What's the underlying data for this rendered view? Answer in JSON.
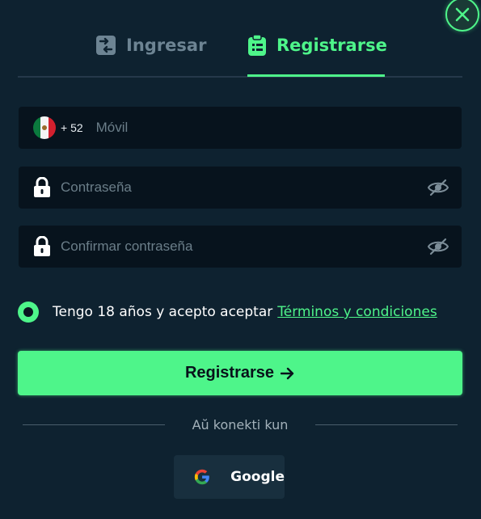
{
  "close": {
    "icon": "close-icon"
  },
  "tabs": {
    "login": {
      "label": "Ingresar",
      "icon": "login-icon"
    },
    "register": {
      "label": "Registrarse",
      "icon": "clipboard-icon",
      "active": true
    }
  },
  "phone": {
    "country": "Mexico",
    "dial_code": "+ 52",
    "placeholder": "Móvil"
  },
  "password": {
    "placeholder": "Contraseña"
  },
  "confirm_password": {
    "placeholder": "Confirmar contraseña"
  },
  "terms": {
    "text": "Tengo 18 años y acepto aceptar",
    "link": "Términos y condiciones",
    "checked": true
  },
  "submit": {
    "label": "Registrarse",
    "icon": "arrow-right-icon"
  },
  "social": {
    "divider": "Aŭ konekti kun",
    "google_label": "Google"
  },
  "colors": {
    "accent": "#4ef58a",
    "background": "#0e2230",
    "field": "#07131d"
  }
}
